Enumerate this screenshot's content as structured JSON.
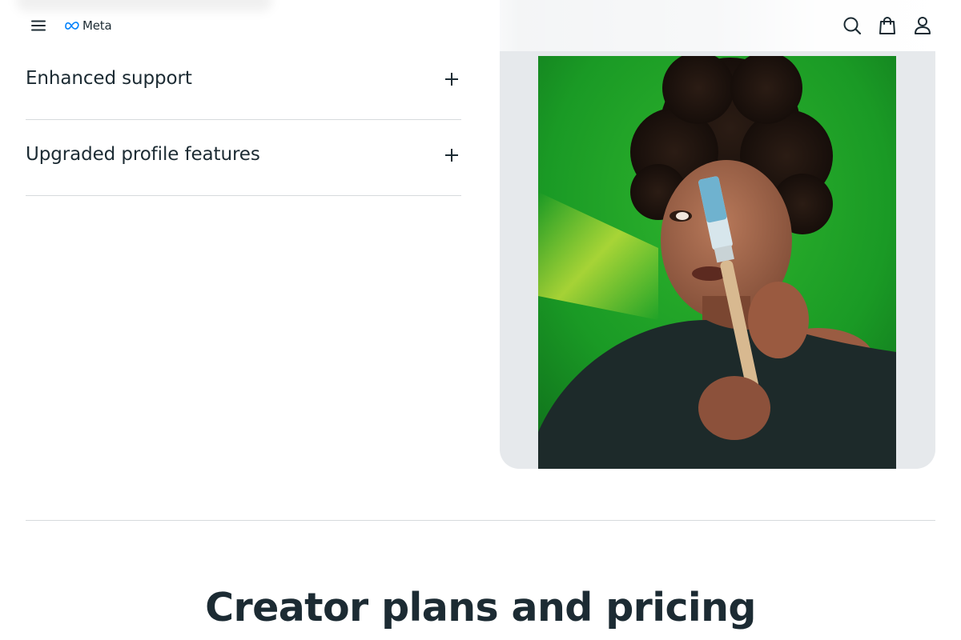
{
  "header": {
    "logo_text": "Meta",
    "menu_icon": "hamburger-menu-icon",
    "search_icon": "search-icon",
    "bag_icon": "shopping-bag-icon",
    "account_icon": "user-account-icon",
    "brand_color": "#0081fb"
  },
  "accordion": {
    "items": [
      {
        "label": "Enhanced support",
        "icon": "plus-icon"
      },
      {
        "label": "Upgraded profile features",
        "icon": "plus-icon"
      }
    ]
  },
  "section": {
    "heading": "Creator plans and pricing"
  },
  "colors": {
    "text": "#1c2b33",
    "divider": "#d6dadd",
    "panel_background": "#e6e9ec",
    "photo_background": "#1e9a26"
  }
}
